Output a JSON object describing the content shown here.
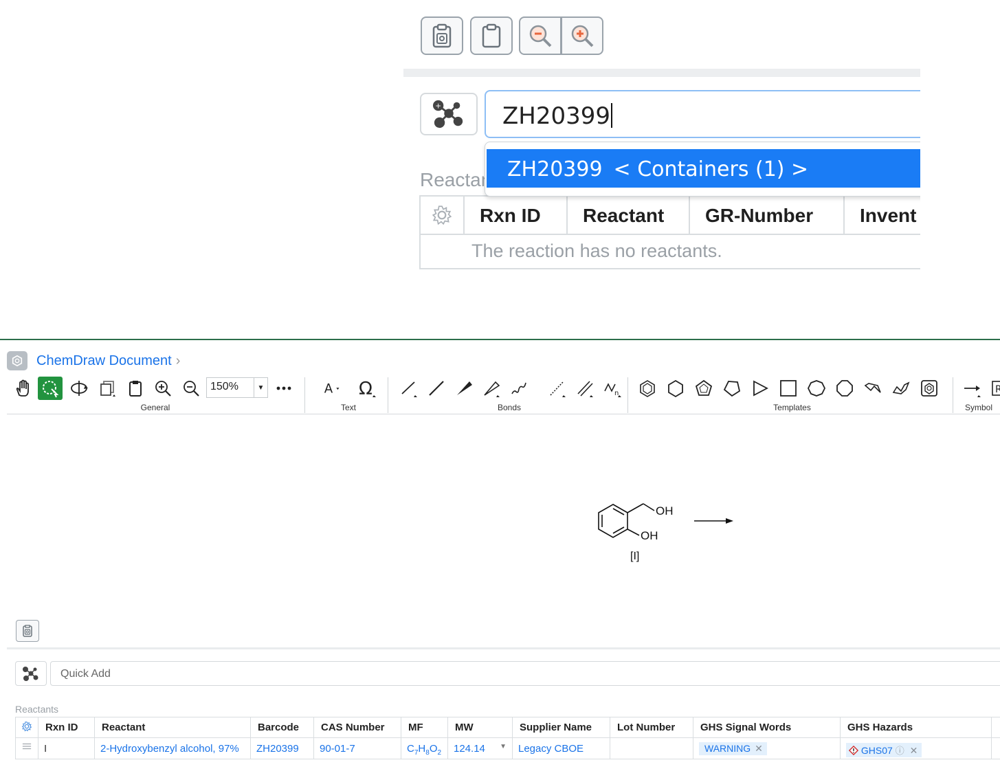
{
  "zoom_panel": {
    "search_value": "ZH20399",
    "dropdown_option_code": "ZH20399",
    "dropdown_option_detail": "< Containers (1) >",
    "reactants_label": "Reactan",
    "table_headers": [
      "Rxn ID",
      "Reactant",
      "GR-Number",
      "Invent"
    ],
    "empty_message": "The reaction has no reactants."
  },
  "chemdraw": {
    "title": "ChemDraw Document",
    "zoom_level": "150%",
    "toolbar_groups": {
      "general": "General",
      "text": "Text",
      "bonds": "Bonds",
      "templates": "Templates",
      "symbols": "Symbol"
    },
    "structure": {
      "label_oh_top": "OH",
      "label_oh_bottom": "OH",
      "compound_label": "[I]"
    }
  },
  "quick_add": {
    "placeholder": "Quick Add"
  },
  "reactants": {
    "label": "Reactants",
    "headers": [
      "Rxn ID",
      "Reactant",
      "Barcode",
      "CAS Number",
      "MF",
      "MW",
      "Supplier Name",
      "Lot Number",
      "GHS Signal Words",
      "GHS Hazards"
    ],
    "row": {
      "rxn_id": "I",
      "reactant": "2-Hydroxybenzyl alcohol, 97%",
      "barcode": "ZH20399",
      "cas": "90-01-7",
      "mf_c": "C",
      "mf_c_n": "7",
      "mf_h": "H",
      "mf_h_n": "8",
      "mf_o": "O",
      "mf_o_n": "2",
      "mw": "124.14",
      "supplier": "Legacy CBOE",
      "lot": "",
      "signal_word": "WARNING",
      "hazard": "GHS07"
    }
  },
  "colors": {
    "accent": "#1a73e8",
    "selection": "#1a7cf5",
    "active_tool": "#22933f",
    "divider": "#2c6e4a"
  }
}
